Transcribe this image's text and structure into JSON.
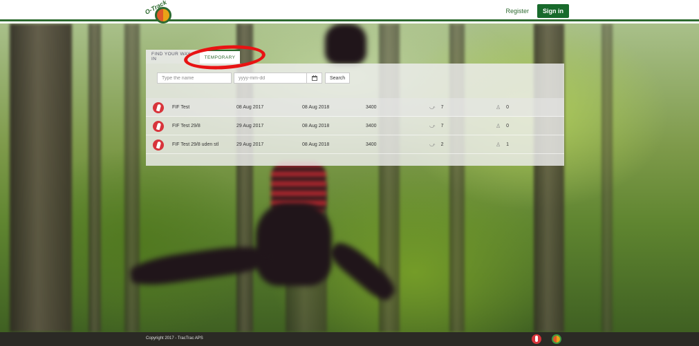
{
  "header": {
    "logo_text": "O-Track",
    "register_label": "Register",
    "signin_label": "Sign in"
  },
  "tabs": [
    {
      "label": "Find your way in"
    },
    {
      "label": "Temporary"
    }
  ],
  "search": {
    "name_placeholder": "Type the name",
    "date_placeholder": "yyyy-mm-dd",
    "search_label": "Search"
  },
  "rows": [
    {
      "name": "FIF Test",
      "start": "08 Aug 2017",
      "end": "08 Aug 2018",
      "count": "3400",
      "runners": "7",
      "hikers": "0"
    },
    {
      "name": "FIF Test 29/8",
      "start": "29 Aug 2017",
      "end": "08 Aug 2018",
      "count": "3400",
      "runners": "7",
      "hikers": "0"
    },
    {
      "name": "FIF Test 29/8 uden stl",
      "start": "29 Aug 2017",
      "end": "08 Aug 2018",
      "count": "3400",
      "runners": "2",
      "hikers": "1"
    }
  ],
  "footer": {
    "copyright": "Copyright 2017 - TracTrac APS"
  },
  "colors": {
    "brand_green": "#2d6a2f",
    "signin_bg": "#186a2c",
    "highlight_red": "#e81313",
    "event_red": "#d8343b"
  }
}
